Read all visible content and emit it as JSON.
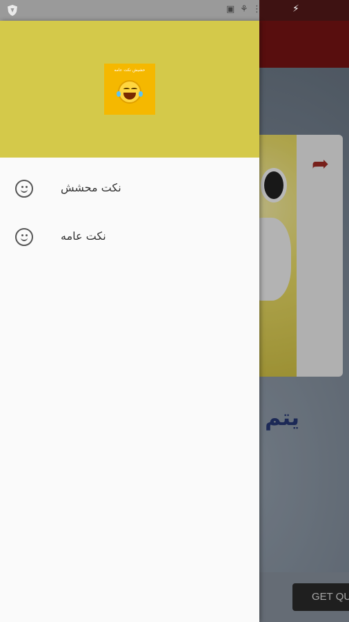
{
  "status_bar": {
    "icons": [
      "shield-icon",
      "battery-icon",
      "wifi-icon",
      "signal-icon",
      "charging-icon"
    ]
  },
  "background": {
    "heading_fragment": "يتم",
    "button_label": "GET QU"
  },
  "drawer": {
    "logo_text": "حشيش نكت عامه",
    "menu": [
      {
        "label": "نكت محشش",
        "icon": "smiley-icon"
      },
      {
        "label": "نكت عامه",
        "icon": "smiley-icon"
      }
    ]
  },
  "colors": {
    "drawer_header": "#d4c94a",
    "logo_bg": "#f5b800",
    "toolbar": "#7a1414",
    "drawer_bg": "#fafafa"
  }
}
